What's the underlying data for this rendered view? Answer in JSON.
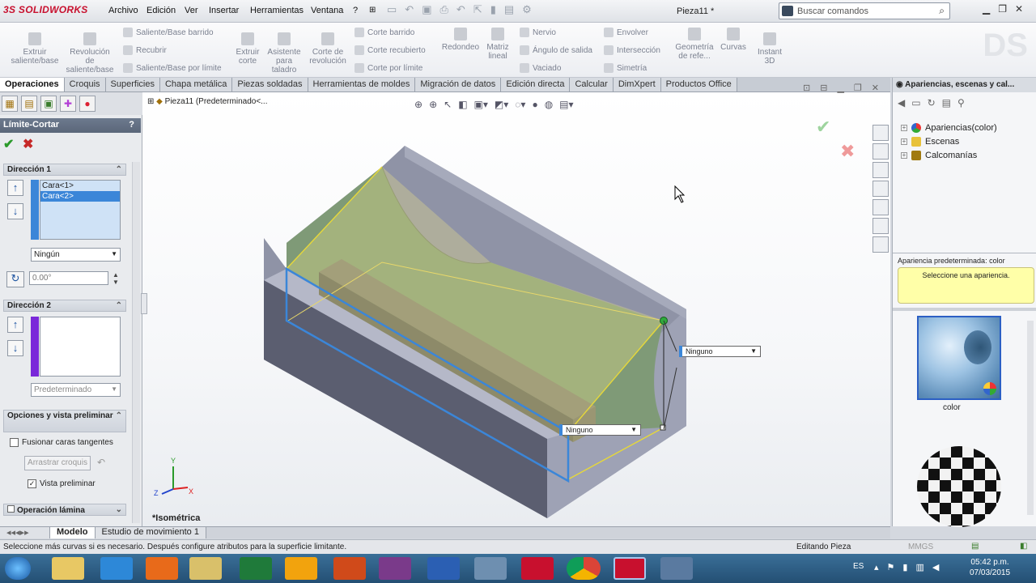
{
  "app": {
    "brand": "SOLIDWORKS",
    "brand_prefix": "3S",
    "doc_title": "Pieza11 *"
  },
  "menu": [
    "Archivo",
    "Edición",
    "Ver",
    "Insertar",
    "Herramientas",
    "Ventana",
    "?"
  ],
  "search": {
    "placeholder": "Buscar comandos"
  },
  "ribbon": {
    "big": [
      "Extruir saliente/base",
      "Revolución de saliente/base",
      "Extruir corte",
      "Asistente para taladro",
      "Corte de revolución",
      "Redondeo",
      "Matriz lineal",
      "Geometría de refe...",
      "Curvas",
      "Instant 3D"
    ],
    "small": [
      "Saliente/Base barrido",
      "Recubrir",
      "Saliente/Base por límite",
      "Corte barrido",
      "Corte recubierto",
      "Corte por límite",
      "Nervio",
      "Ángulo de salida",
      "Vaciado",
      "Envolver",
      "Intersección",
      "Simetría"
    ]
  },
  "tabs": [
    "Operaciones",
    "Croquis",
    "Superficies",
    "Chapa metálica",
    "Piezas soldadas",
    "Herramientas de moldes",
    "Migración de datos",
    "Edición directa",
    "Calcular",
    "DimXpert",
    "Productos Office"
  ],
  "property_manager": {
    "title": "Límite-Cortar",
    "help": "?",
    "ok_icon": "✔",
    "cancel_icon": "✖",
    "dir1": {
      "header": "Dirección 1",
      "items": [
        "Cara<1>",
        "Cara<2>"
      ],
      "tangency": "Ningún",
      "angle": "0.00°"
    },
    "dir2": {
      "header": "Dirección 2",
      "tangency": "Predeterminado"
    },
    "options": {
      "header": "Opciones y vista preliminar",
      "merge_tangent": "Fusionar caras tangentes",
      "drag_sketch": "Arrastrar croquis",
      "preview": "Vista preliminar"
    },
    "thin": {
      "header": "Operación lámina"
    }
  },
  "viewport": {
    "tree_label": "Pieza11 (Predeterminado<...",
    "view_label": "*Isométrica",
    "callout1": "Ninguno",
    "callout2": "Ninguno",
    "triad": {
      "y": "Y",
      "z": "Z",
      "x": "X"
    }
  },
  "appearances": {
    "title": "Apariencias, escenas y cal...",
    "tree": [
      "Apariencias(color)",
      "Escenas",
      "Calcomanías"
    ],
    "default_label": "Apariencia predeterminada: color",
    "hint": "Seleccione una apariencia.",
    "swatch_label": "color"
  },
  "bottom_tabs": [
    "Modelo",
    "Estudio de movimiento 1"
  ],
  "status": {
    "message": "Seleccione más curvas si es necesario. Después configure atributos para la superficie limitante.",
    "mode": "Editando Pieza",
    "units": "MMGS"
  },
  "taskbar": {
    "lang": "ES",
    "time": "05:42 p.m.",
    "date": "07/03/2015"
  }
}
